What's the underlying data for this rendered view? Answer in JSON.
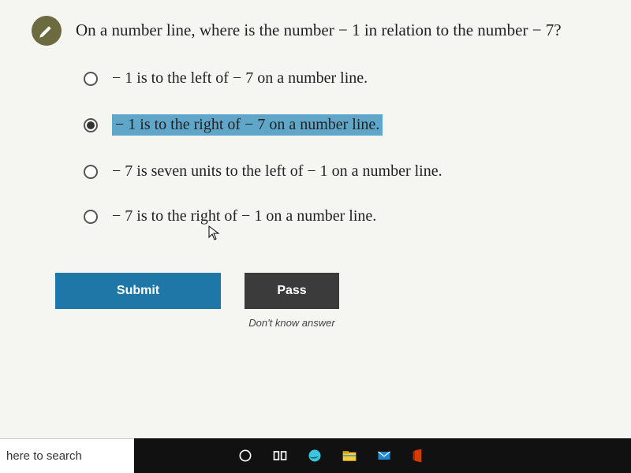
{
  "question": {
    "icon": "pencil-icon",
    "text": "On a number line, where is the number − 1 in relation to the number − 7?"
  },
  "options": [
    {
      "label": "− 1 is to the left of − 7 on a number line.",
      "selected": false
    },
    {
      "label": "− 1 is to the right of − 7 on a number line.",
      "selected": true
    },
    {
      "label": "− 7 is seven units to the left of − 1 on a number line.",
      "selected": false
    },
    {
      "label": "− 7 is to the right of − 1 on a number line.",
      "selected": false
    }
  ],
  "buttons": {
    "submit": "Submit",
    "pass": "Pass",
    "dont_know": "Don't know answer"
  },
  "taskbar": {
    "search_placeholder": "here to search",
    "icons": [
      "cortana-circle-icon",
      "task-view-icon",
      "edge-icon",
      "file-explorer-icon",
      "mail-icon",
      "office-icon"
    ]
  },
  "colors": {
    "submit_bg": "#1f77a8",
    "pass_bg": "#3b3b3b",
    "badge_bg": "#6b6b3f",
    "highlight_bg": "#5fa6c9"
  }
}
